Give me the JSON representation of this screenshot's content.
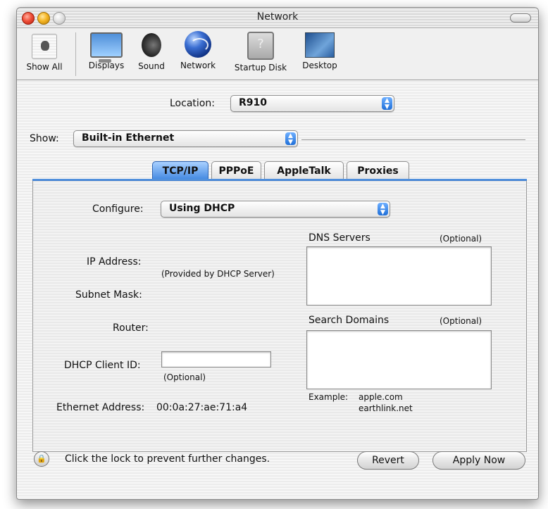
{
  "window": {
    "title": "Network"
  },
  "toolbar": {
    "items": [
      {
        "label": "Show All",
        "icon": "apple-icon"
      },
      {
        "label": "Displays",
        "icon": "display-icon"
      },
      {
        "label": "Sound",
        "icon": "speaker-icon"
      },
      {
        "label": "Network",
        "icon": "globe-icon"
      },
      {
        "label": "Startup Disk",
        "icon": "disk-icon"
      },
      {
        "label": "Desktop",
        "icon": "desktop-icon"
      }
    ]
  },
  "location": {
    "label": "Location:",
    "value": "R910"
  },
  "show": {
    "label": "Show:",
    "value": "Built-in Ethernet"
  },
  "tabs": [
    {
      "label": "TCP/IP",
      "active": true
    },
    {
      "label": "PPPoE"
    },
    {
      "label": "AppleTalk"
    },
    {
      "label": "Proxies"
    }
  ],
  "tcpip": {
    "configure_label": "Configure:",
    "configure_value": "Using DHCP",
    "ip_address_label": "IP Address:",
    "provided_note": "(Provided by DHCP Server)",
    "subnet_mask_label": "Subnet Mask:",
    "router_label": "Router:",
    "dhcp_client_id_label": "DHCP Client ID:",
    "dhcp_client_id_value": "",
    "dhcp_optional": "(Optional)",
    "ethernet_address_label": "Ethernet Address:",
    "ethernet_address_value": "00:0a:27:ae:71:a4",
    "dns_servers_label": "DNS Servers",
    "dns_optional": "(Optional)",
    "search_domains_label": "Search Domains",
    "search_optional": "(Optional)",
    "example_label": "Example:",
    "example_line1": "apple.com",
    "example_line2": "earthlink.net"
  },
  "footer": {
    "lock_text": "Click the lock to prevent further changes.",
    "revert_label": "Revert",
    "apply_label": "Apply Now"
  },
  "colors": {
    "accent": "#3f86e0"
  }
}
